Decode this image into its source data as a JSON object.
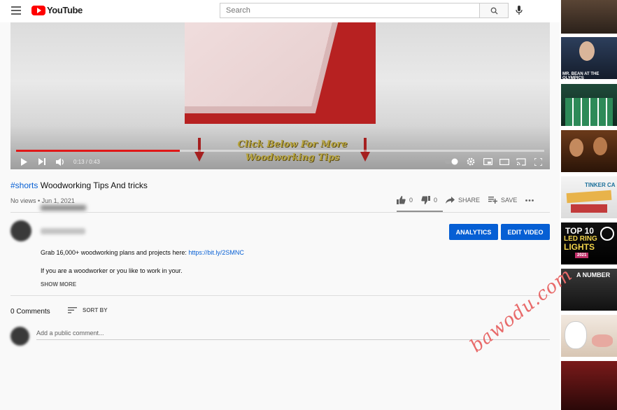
{
  "header": {
    "logo_text": "YouTube",
    "search_placeholder": "Search"
  },
  "player": {
    "overlay_line1": "Click Below For More",
    "overlay_line2": "Woodworking Tips",
    "time_display": "0:13 / 0:43",
    "progress_fraction": 0.31
  },
  "video_info": {
    "hashtag": "#shorts",
    "title": "Woodworking Tips And tricks",
    "meta": "No views • Jun 1, 2021",
    "like_count": "0",
    "dislike_count": "0",
    "share_label": "SHARE",
    "save_label": "SAVE"
  },
  "owner": {
    "analytics_label": "ANALYTICS",
    "edit_video_label": "EDIT VIDEO"
  },
  "description": {
    "line1_prefix": "Grab 16,000+ woodworking plans and projects here: ",
    "line1_link": "https://bit.ly/2SMNC",
    "line2": "If you are a woodworker or you like to work in your.",
    "show_more": "SHOW MORE"
  },
  "comments": {
    "count_label": "0 Comments",
    "sort_label": "SORT BY",
    "placeholder": "Add a public comment..."
  },
  "sidebar": {
    "thumb2_caption": "MR. BEAN AT THE OLYMPICS",
    "thumb5_caption": "TINKER CA",
    "thumb6_line1": "TOP 10",
    "thumb6_line2": "LED RING",
    "thumb6_line3": "LIGHTS",
    "thumb6_year": "2021",
    "thumb7_caption": "A NUMBER"
  },
  "watermark": "bawodu.com",
  "colors": {
    "brand_red": "#ff0000",
    "accent_blue": "#065fd4",
    "progress_red": "#e01818"
  }
}
